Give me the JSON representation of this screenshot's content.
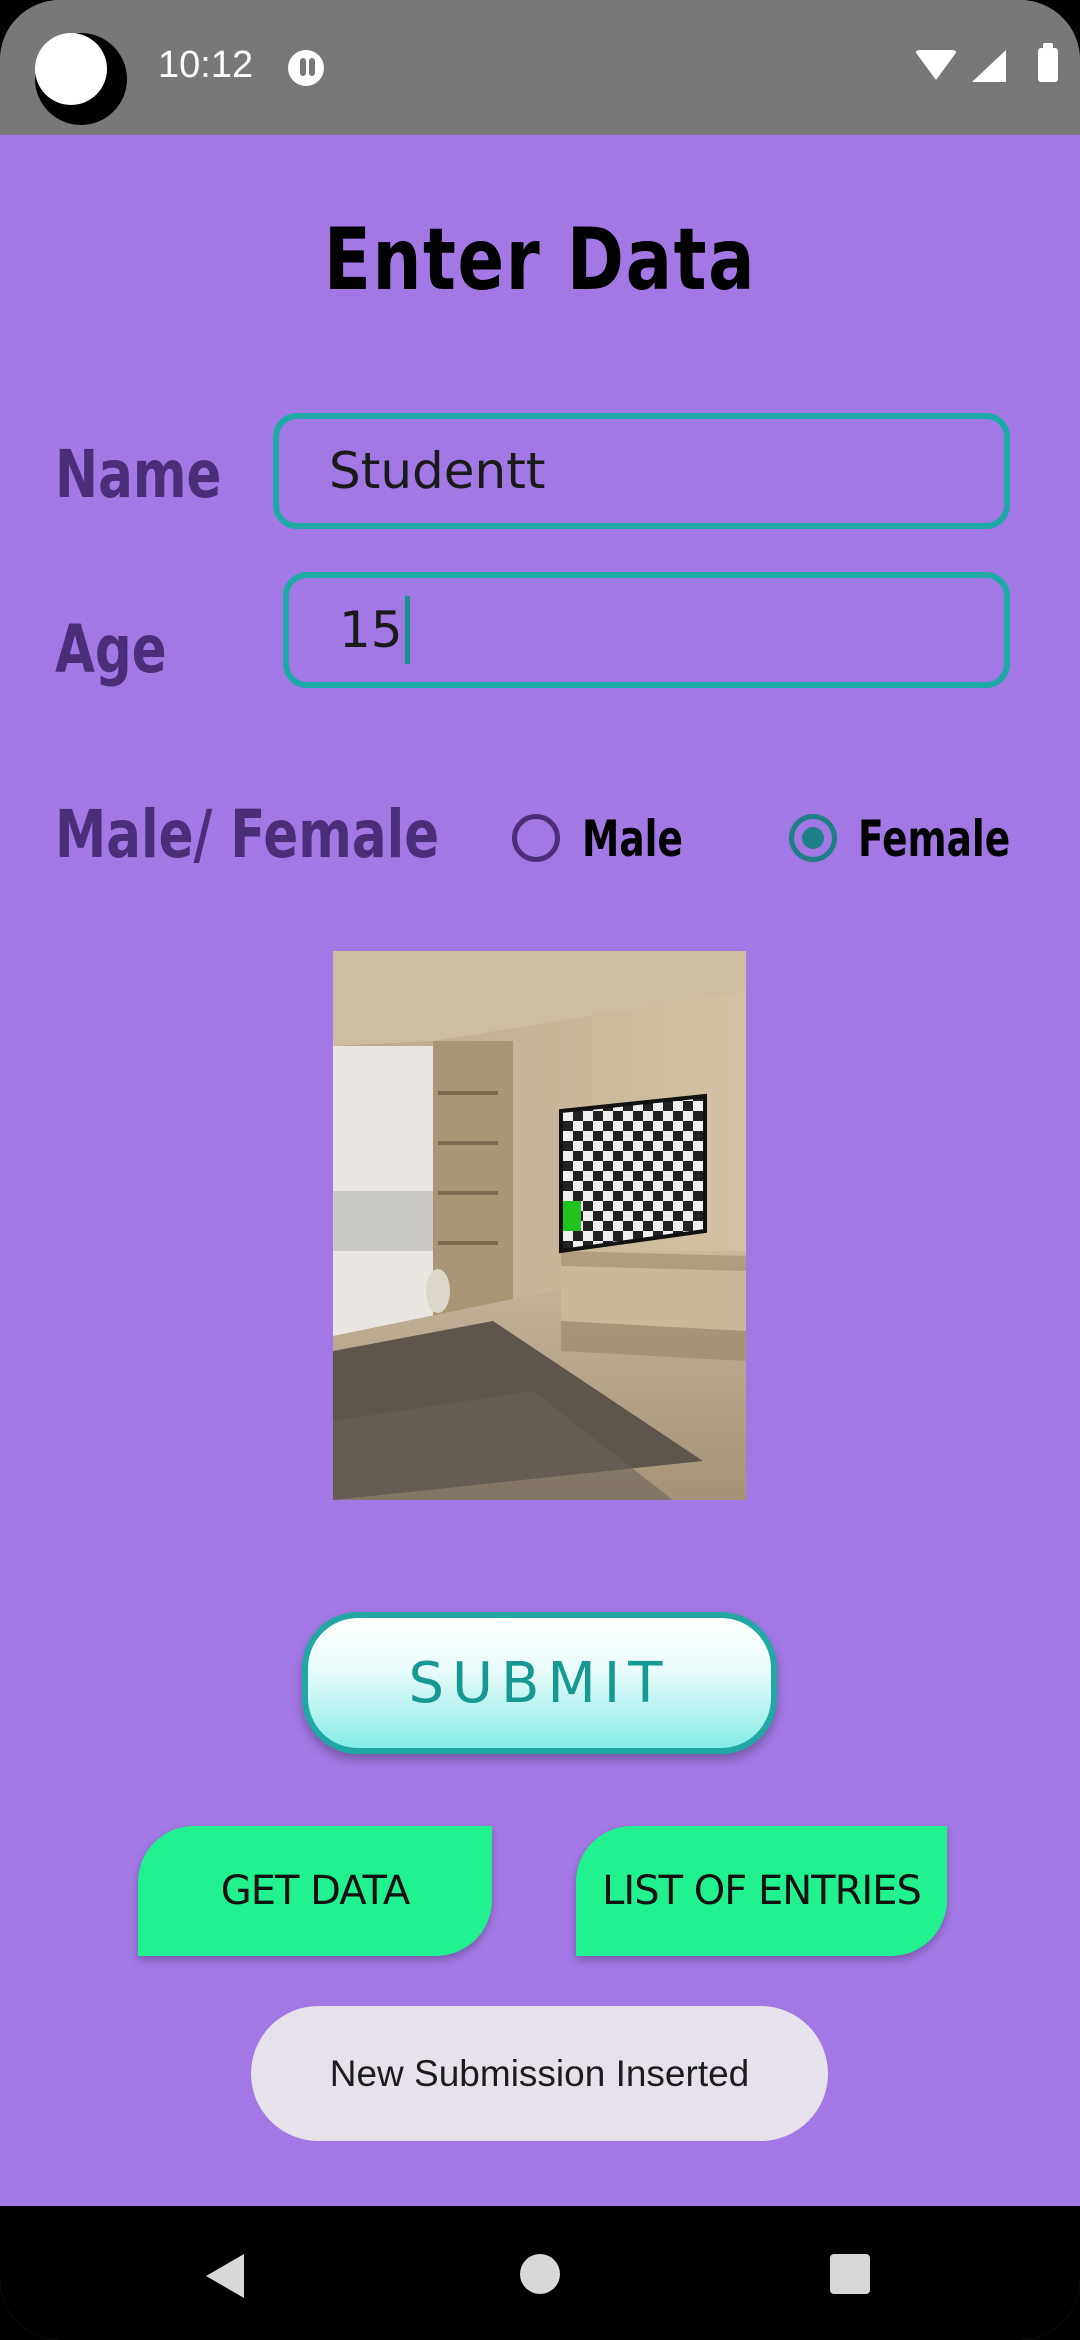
{
  "status_bar": {
    "time": "10:12"
  },
  "page": {
    "title": "Enter  Data"
  },
  "form": {
    "name_label": "Name",
    "name_value": "Studentt",
    "age_label": "Age",
    "age_value": "15",
    "gender_label": "Male/ Female",
    "gender_options": [
      {
        "label": "Male",
        "selected": false
      },
      {
        "label": "Female",
        "selected": true
      }
    ]
  },
  "buttons": {
    "submit_label": "SUBMIT",
    "get_data_label": "GET DATA",
    "list_entries_label": "LIST OF ENTRIES"
  },
  "toast": {
    "message": "New Submission Inserted"
  },
  "colors": {
    "background": "#a178e4",
    "label": "#4b2e7a",
    "field_border": "#1ea9a6",
    "green_button": "#21f28f",
    "submit_text": "#179893"
  },
  "icons": [
    "wifi-icon",
    "signal-icon",
    "battery-icon",
    "back-icon",
    "home-icon",
    "recents-icon"
  ]
}
